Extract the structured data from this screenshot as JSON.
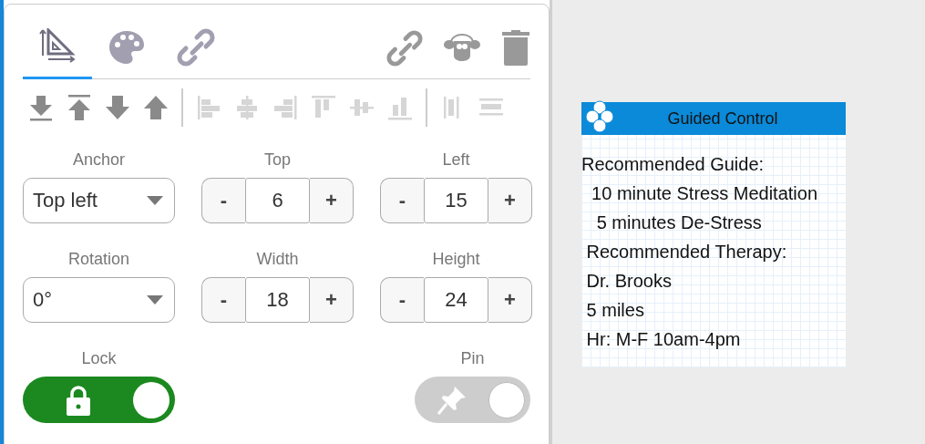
{
  "tabs": [
    {
      "kind": "geometry",
      "selected": true
    },
    {
      "kind": "style",
      "selected": false
    },
    {
      "kind": "link",
      "selected": false
    }
  ],
  "toolbar": [
    {
      "kind": "to-bottom",
      "disabled": false
    },
    {
      "kind": "to-top",
      "disabled": false
    },
    {
      "kind": "down",
      "disabled": false
    },
    {
      "kind": "up",
      "disabled": false
    },
    {
      "kind": "separator"
    },
    {
      "kind": "align-left",
      "disabled": true
    },
    {
      "kind": "align-center",
      "disabled": true
    },
    {
      "kind": "align-right",
      "disabled": true
    },
    {
      "kind": "align-top",
      "disabled": true
    },
    {
      "kind": "align-middle",
      "disabled": true
    },
    {
      "kind": "align-bottom",
      "disabled": true
    },
    {
      "kind": "separator"
    },
    {
      "kind": "distribute-h",
      "disabled": true
    },
    {
      "kind": "distribute-v",
      "disabled": true
    }
  ],
  "fields": [
    {
      "kind": "select",
      "label": "Anchor",
      "value": "Top left"
    },
    {
      "kind": "stepper",
      "label": "Top",
      "value": "6",
      "decrement": "-",
      "increment": "+"
    },
    {
      "kind": "stepper",
      "label": "Left",
      "value": "15",
      "decrement": "-",
      "increment": "+"
    },
    {
      "kind": "select",
      "label": "Rotation",
      "value": "0°"
    },
    {
      "kind": "stepper",
      "label": "Width",
      "value": "18",
      "decrement": "-",
      "increment": "+"
    },
    {
      "kind": "stepper",
      "label": "Height",
      "value": "24",
      "decrement": "-",
      "increment": "+"
    }
  ],
  "toggles": [
    {
      "kind": "lock",
      "label": "Lock",
      "on": true
    },
    {
      "kind": "pin",
      "label": "Pin",
      "on": false
    }
  ],
  "card": {
    "title": "Guided Control",
    "lines": [
      "Recommended Guide:",
      "  10 minute Stress Meditation",
      "   5 minutes De-Stress",
      " Recommended Therapy:",
      " Dr. Brooks",
      " 5 miles",
      " Hr: M-F 10am-4pm"
    ]
  }
}
